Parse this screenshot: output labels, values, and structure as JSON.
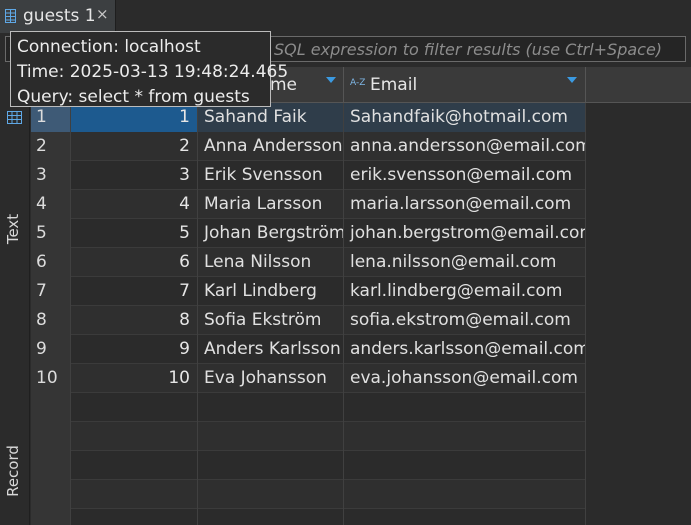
{
  "tab": {
    "title": "guests 1",
    "close": "×"
  },
  "filter": {
    "placeholder": "SQL expression to filter results (use Ctrl+Space)"
  },
  "tooltip": {
    "connection": "Connection: localhost",
    "time": "Time: 2025-03-13 19:48:24.465",
    "query": "Query: select * from guests"
  },
  "side": {
    "text_label": "Text",
    "record_label": "Record"
  },
  "columns": [
    {
      "label": "me"
    },
    {
      "label": "Email"
    }
  ],
  "rows": [
    {
      "n": "1",
      "id": "1",
      "name": "Sahand Faik",
      "email": "Sahandfaik@hotmail.com"
    },
    {
      "n": "2",
      "id": "2",
      "name": "Anna Andersson",
      "email": "anna.andersson@email.com"
    },
    {
      "n": "3",
      "id": "3",
      "name": "Erik Svensson",
      "email": "erik.svensson@email.com"
    },
    {
      "n": "4",
      "id": "4",
      "name": "Maria Larsson",
      "email": "maria.larsson@email.com"
    },
    {
      "n": "5",
      "id": "5",
      "name": "Johan Bergström",
      "email": "johan.bergstrom@email.com"
    },
    {
      "n": "6",
      "id": "6",
      "name": "Lena Nilsson",
      "email": "lena.nilsson@email.com"
    },
    {
      "n": "7",
      "id": "7",
      "name": "Karl Lindberg",
      "email": "karl.lindberg@email.com"
    },
    {
      "n": "8",
      "id": "8",
      "name": "Sofia Ekström",
      "email": "sofia.ekstrom@email.com"
    },
    {
      "n": "9",
      "id": "9",
      "name": "Anders Karlsson",
      "email": "anders.karlsson@email.com"
    },
    {
      "n": "10",
      "id": "10",
      "name": "Eva Johansson",
      "email": "eva.johansson@email.com"
    }
  ],
  "colors": {
    "accent": "#3b9ae1",
    "selected": "#1d5a8f",
    "background": "#2b2b2b"
  }
}
